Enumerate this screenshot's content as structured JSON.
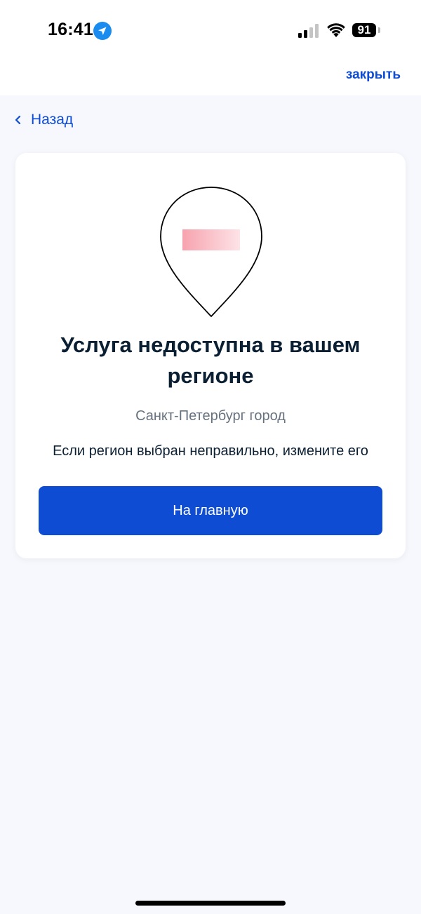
{
  "status_bar": {
    "time": "16:41",
    "battery": "91"
  },
  "header": {
    "close_label": "закрыть"
  },
  "nav": {
    "back_label": "Назад"
  },
  "card": {
    "title": "Услуга недоступна в вашем регионе",
    "region": "Санкт-Петербург город",
    "hint": "Если регион выбран неправильно, измените его",
    "button_label": "На главную"
  },
  "icons": {
    "location": "location-arrow-icon",
    "signal": "cellular-signal-icon",
    "wifi": "wifi-icon",
    "back": "chevron-left-icon",
    "pin": "map-pin-illustration"
  },
  "colors": {
    "accent": "#0d4cd3",
    "background": "#f7f8fd",
    "text": "#0b1f33",
    "muted": "#66727f",
    "pin_flag": "#f7a9b3"
  }
}
